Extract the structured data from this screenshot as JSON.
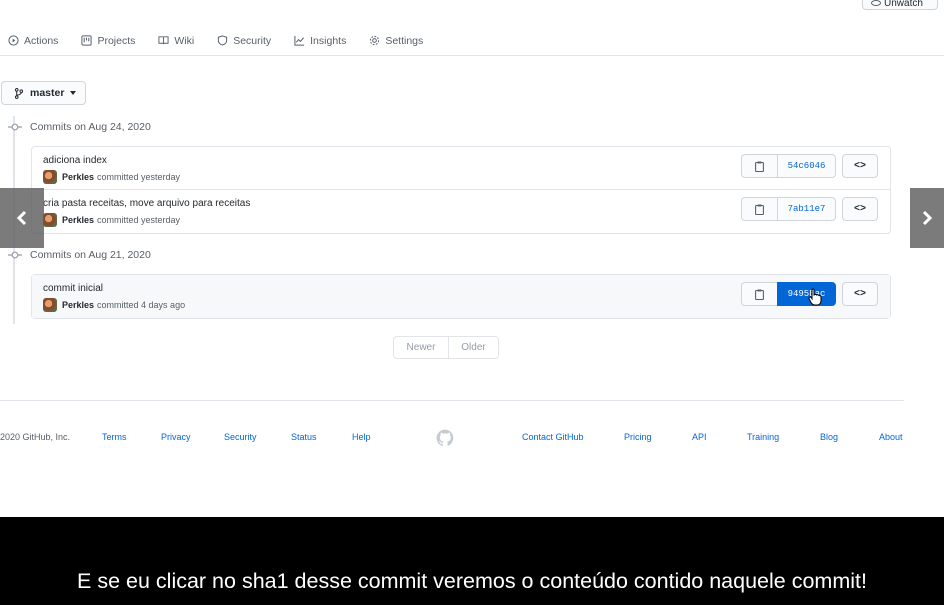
{
  "header": {
    "unwatch_label": "Unwatch"
  },
  "repo_nav": [
    {
      "label": "Actions",
      "icon": "play-circle-icon"
    },
    {
      "label": "Projects",
      "icon": "project-icon"
    },
    {
      "label": "Wiki",
      "icon": "book-icon"
    },
    {
      "label": "Security",
      "icon": "shield-icon"
    },
    {
      "label": "Insights",
      "icon": "graph-icon"
    },
    {
      "label": "Settings",
      "icon": "gear-icon"
    }
  ],
  "branch": {
    "label": "master"
  },
  "commit_groups": [
    {
      "title": "Commits on Aug 24, 2020",
      "commits": [
        {
          "message": "adiciona index",
          "author": "Perkles",
          "meta": "committed yesterday",
          "sha": "54c6046"
        },
        {
          "message": "cria pasta receitas, move arquivo para receitas",
          "author": "Perkles",
          "meta": "committed yesterday",
          "sha": "7ab11e7"
        }
      ]
    },
    {
      "title": "Commits on Aug 21, 2020",
      "commits": [
        {
          "message": "commit inicial",
          "author": "Perkles",
          "meta": "committed 4 days ago",
          "sha": "9495Eac"
        }
      ]
    }
  ],
  "pagination": {
    "newer": "Newer",
    "older": "Older"
  },
  "footer": {
    "copyright": "2020 GitHub, Inc.",
    "links": {
      "terms": "Terms",
      "privacy": "Privacy",
      "security": "Security",
      "status": "Status",
      "help": "Help",
      "contact": "Contact GitHub",
      "pricing": "Pricing",
      "api": "API",
      "training": "Training",
      "blog": "Blog",
      "about": "About"
    }
  },
  "subtitle": "E se eu clicar no sha1 desse commit veremos o conteúdo contido naquele commit!",
  "colors": {
    "accent": "#0366d6",
    "muted": "#586069",
    "border": "#e1e4e8"
  }
}
